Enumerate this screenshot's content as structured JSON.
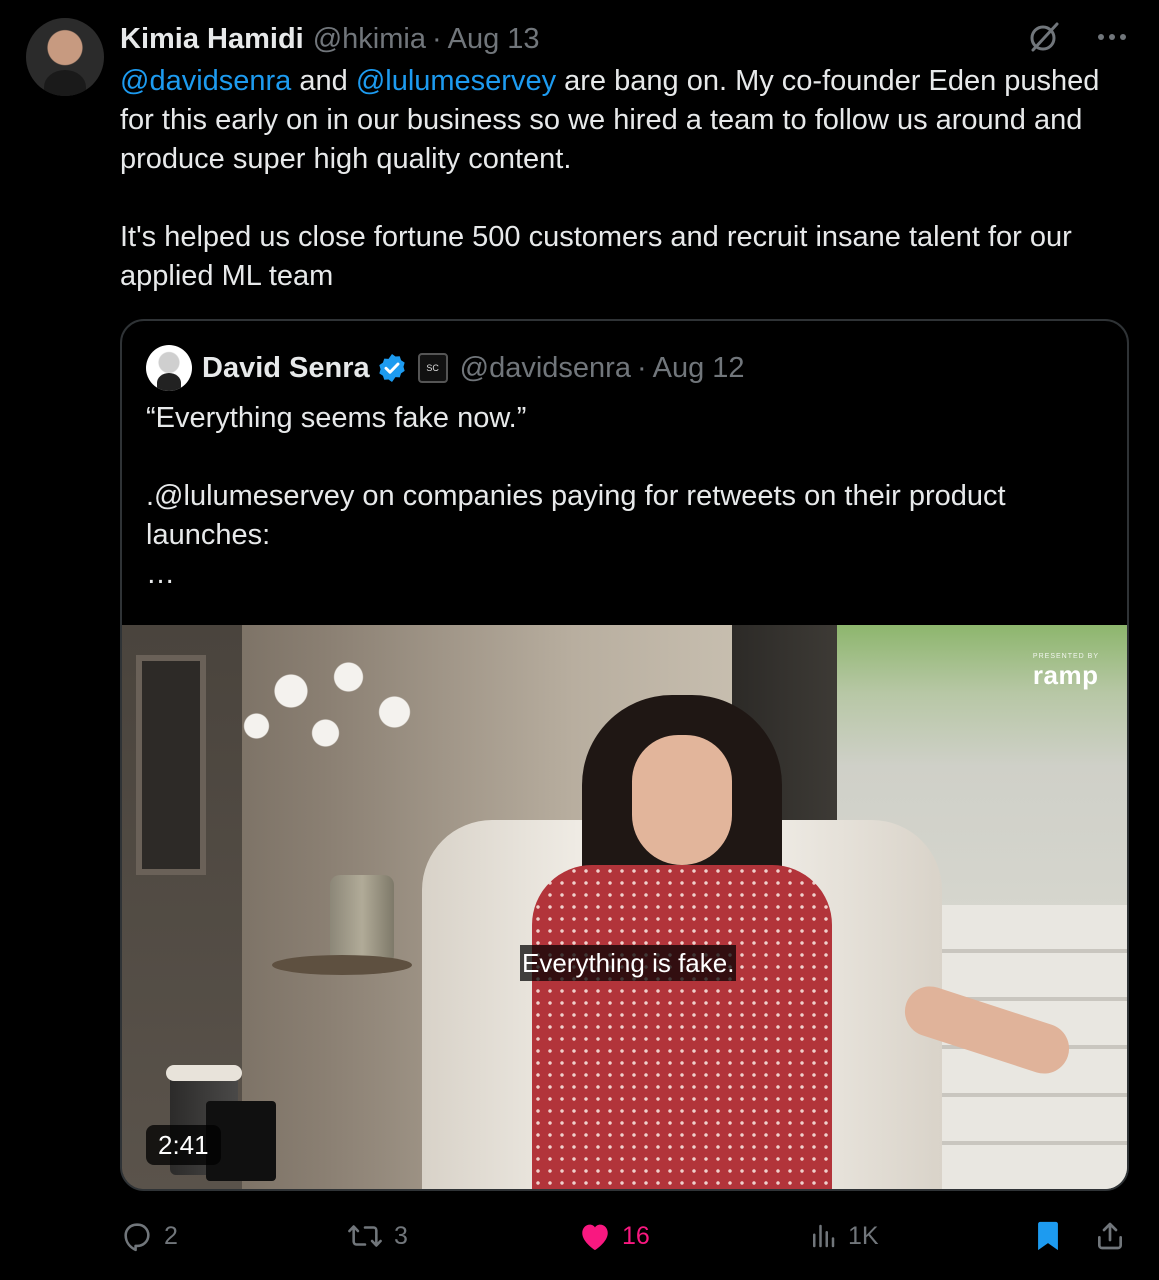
{
  "tweet": {
    "author_name": "Kimia Hamidi",
    "author_handle": "@hkimia",
    "separator": "·",
    "date": "Aug 13",
    "text_mention_1": "@davidsenra",
    "text_part_1": " and ",
    "text_mention_2": "@lulumeservey",
    "text_part_2": " are bang on. My co-founder Eden pushed for this early on in our business so we hired a team to follow us around and produce super high quality content.\n\nIt's helped us close fortune 500 customers and recruit insane talent for our applied ML team"
  },
  "quote": {
    "author_name": "David Senra",
    "affiliation_badge": "SC",
    "author_handle": "@davidsenra",
    "separator": "·",
    "date": "Aug 12",
    "text": "“Everything seems fake now.”\n\n.@lulumeservey on companies paying for retweets on their product launches:\n…",
    "media": {
      "caption": "Everything is fake.",
      "duration": "2:41",
      "sponsor_small": "PRESENTED BY",
      "sponsor": "ramp"
    }
  },
  "actions": {
    "replies": "2",
    "reposts": "3",
    "likes": "16",
    "views": "1K"
  },
  "colors": {
    "background": "#000000",
    "text": "#e7e9ea",
    "secondary": "#71767b",
    "link": "#1d9bf0",
    "like": "#f91880",
    "bookmark": "#1d9bf0"
  },
  "icons": [
    "grok-icon",
    "more-icon",
    "verified-icon",
    "reply-icon",
    "repost-icon",
    "like-icon",
    "views-icon",
    "bookmark-icon",
    "share-icon"
  ]
}
